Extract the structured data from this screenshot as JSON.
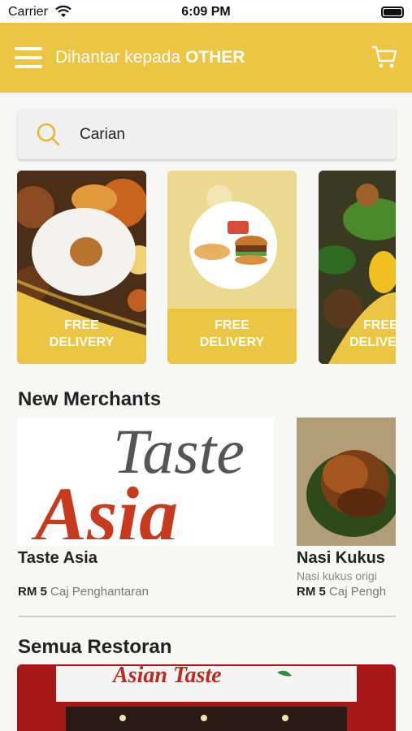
{
  "status_bar": {
    "carrier": "Carrier",
    "time": "6:09 PM"
  },
  "header": {
    "deliver_prefix": "Dihantar kepada",
    "deliver_location": "OTHER"
  },
  "search": {
    "placeholder": "Carian"
  },
  "promos": [
    {
      "label_line1": "FREE",
      "label_line2": "DELIVERY"
    },
    {
      "label_line1": "FREE",
      "label_line2": "DELIVERY"
    },
    {
      "label_line1": "FREE",
      "label_line2": "DELIVE"
    }
  ],
  "new_merchants": {
    "title": "New Merchants",
    "items": [
      {
        "name": "Taste Asia",
        "fee_value": "RM 5",
        "fee_label": "Caj Penghantaran",
        "logo_line1": "Taste",
        "logo_line2": "Asia"
      },
      {
        "name": "Nasi Kukus",
        "description": "Nasi kukus origi",
        "fee_value": "RM 5",
        "fee_label": "Caj Pengh"
      }
    ]
  },
  "all_restaurants": {
    "title": "Semua Restoran",
    "sign_text": "Asian Taste"
  },
  "colors": {
    "accent": "#ecc542"
  }
}
